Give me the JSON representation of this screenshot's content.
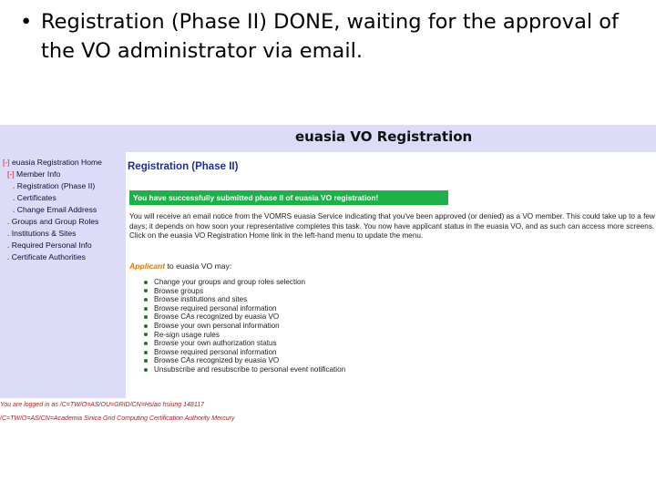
{
  "slide": {
    "bullet_symbol": "•",
    "text": "Registration (Phase II) DONE, waiting for the approval of the VO administrator via email."
  },
  "screenshot": {
    "page_title": "euasia VO Registration",
    "nav": [
      {
        "toggle": "[-]",
        "label": "euasia Registration Home"
      },
      {
        "toggle": "[-]",
        "label": "Member Info"
      },
      {
        "toggle": "",
        "label": "Registration (Phase II)"
      },
      {
        "toggle": "",
        "label": "Certificates"
      },
      {
        "toggle": "",
        "label": "Change Email Address"
      },
      {
        "toggle": "",
        "label": "Groups and Group Roles"
      },
      {
        "toggle": "",
        "label": "Institutions & Sites"
      },
      {
        "toggle": "",
        "label": "Required Personal Info"
      },
      {
        "toggle": "",
        "label": "Certificate Authorities"
      }
    ],
    "heading": "Registration (Phase II)",
    "success_message": "You have successfully submitted phase II of euasia VO registration!",
    "paragraph": "You will receive an email notice from the VOMRS euasia Service indicating that you've been approved (or denied) as a VO member. This could take up to a few days; it depends on how soon your representative completes this task. You now have applicant status in the euasia VO, and as such can access more screens. Click on the euasia VO Registration Home link in the left-hand menu to update the menu.",
    "applicant_word": "Applicant",
    "applicant_rest": " to euasia VO may:",
    "permissions": [
      "Change your groups and group roles selection",
      "Browse groups",
      "Browse institutions and sites",
      "Browse required personal information",
      "Browse CAs recognized by euasia VO",
      "Browse your own personal information",
      "Re-sign usage rules",
      "Browse your own authorization status",
      "Browse required personal information",
      "Browse CAs recognized by euasia VO",
      "Unsubscribe and resubscribe to personal event notification"
    ],
    "footer_login": "You are logged in as /C=TW/O=AS/OU=GRID/CN=Hsiao hsiung 148117",
    "footer_ca": "/C=TW/O=AS/CN=Academia Sinica Grid Computing Certification Authority Mercury"
  }
}
